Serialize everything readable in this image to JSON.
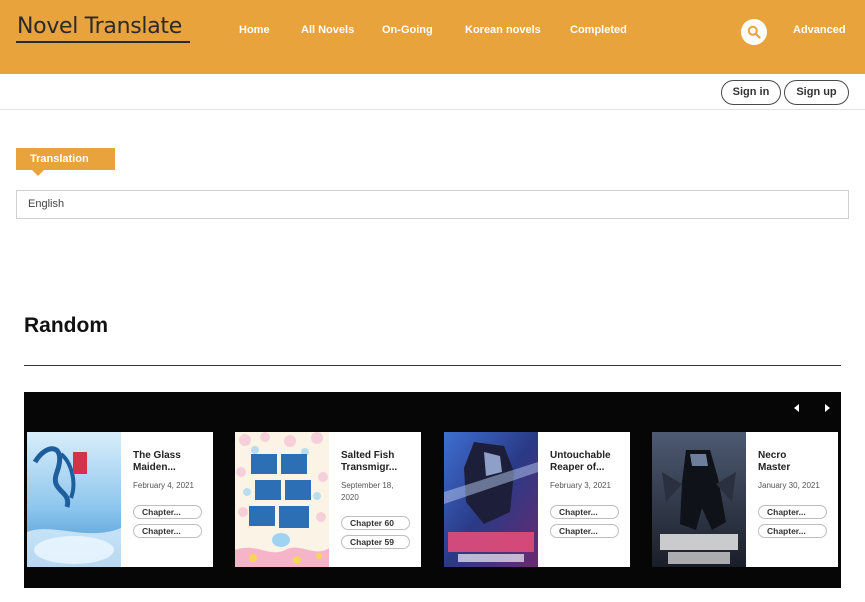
{
  "header": {
    "logo": "Novel Translate",
    "nav": [
      "Home",
      "All Novels",
      "On-Going",
      "Korean novels",
      "Completed"
    ],
    "advanced": "Advanced"
  },
  "user": {
    "sign_in": "Sign in",
    "sign_up": "Sign up"
  },
  "translation": {
    "label": "Translation",
    "selected": "English"
  },
  "random": {
    "title": "Random",
    "novels": [
      {
        "title_lines": [
          "The Glass",
          "Maiden..."
        ],
        "date": "February 4, 2021",
        "chapters": [
          "Chapter...",
          "Chapter..."
        ]
      },
      {
        "title_lines": [
          "Salted Fish",
          "Transmigr..."
        ],
        "date_lines": [
          "September 18,",
          "2020"
        ],
        "chapters": [
          "Chapter 60",
          "Chapter 59"
        ]
      },
      {
        "title_lines": [
          "Untouchable",
          "Reaper of..."
        ],
        "date": "February 3, 2021",
        "chapters": [
          "Chapter...",
          "Chapter..."
        ]
      },
      {
        "title_lines": [
          "Necro",
          "Master"
        ],
        "date": "January 30, 2021",
        "chapters": [
          "Chapter...",
          "Chapter..."
        ]
      }
    ]
  },
  "colors": {
    "accent": "#e8a33d",
    "slider_bg": "#060606"
  }
}
